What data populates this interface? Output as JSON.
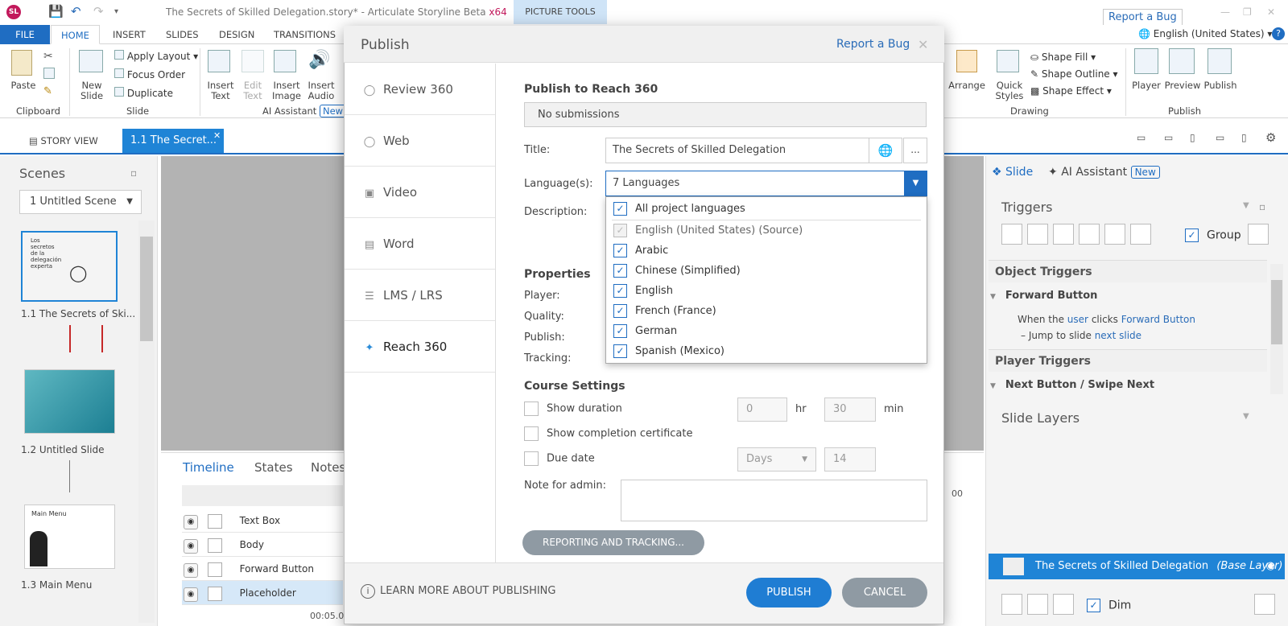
{
  "app": {
    "logo": "SL",
    "window_title": "The Secrets of Skilled Delegation.story* - Articulate Storyline Beta",
    "arch": "x64",
    "picture_tools": "PICTURE TOOLS",
    "report_bug": "Report a Bug",
    "language": "English (United States)",
    "accent": "#1f6dc2"
  },
  "ribbon_tabs": [
    "FILE",
    "HOME",
    "INSERT",
    "SLIDES",
    "DESIGN",
    "TRANSITIONS"
  ],
  "ribbon": {
    "paste": "Paste",
    "clipboard": "Clipboard",
    "new_slide": "New Slide",
    "apply_layout": "Apply Layout",
    "focus_order": "Focus Order",
    "duplicate": "Duplicate",
    "slide_group": "Slide",
    "insert_text": "Insert Text",
    "edit_text": "Edit Text",
    "insert_image": "Insert Image",
    "insert_audio": "Insert Audio",
    "ai_assistant": "AI Assistant",
    "new_badge": "New",
    "arrange": "Arrange",
    "quick_styles": "Quick Styles",
    "shape_fill": "Shape Fill",
    "shape_outline": "Shape Outline",
    "shape_effect": "Shape Effect",
    "drawing": "Drawing",
    "player": "Player",
    "preview": "Preview",
    "publish": "Publish",
    "publish_group": "Publish"
  },
  "strip": {
    "story_view": "STORY VIEW",
    "slide_tab": "1.1 The Secret..."
  },
  "scenes": {
    "title": "Scenes",
    "selected_scene": "1 Untitled Scene",
    "slides": [
      {
        "label": "1.1 The Secrets of Ski..."
      },
      {
        "label": "1.2 Untitled Slide"
      },
      {
        "label": "1.3 Main Menu"
      }
    ],
    "thumb_texts": [
      "Los secretos de la delegación experta",
      "Main Menu"
    ]
  },
  "timeline": {
    "tabs": [
      "Timeline",
      "States",
      "Notes"
    ],
    "rows": [
      "Text Box",
      "Body",
      "Forward Button",
      "Placeholder"
    ],
    "time": "00:05.00",
    "ruler": "00"
  },
  "right_panel": {
    "tab_slide": "Slide",
    "tab_ai": "AI Assistant",
    "new_badge": "New",
    "triggers": "Triggers",
    "group": "Group",
    "object_triggers": "Object Triggers",
    "forward_button": "Forward Button",
    "when_prefix": "When the",
    "when_user": "user",
    "when_clicks": "clicks",
    "when_target": "Forward Button",
    "jump_prefix": "Jump to slide",
    "jump_target": "next slide",
    "player_triggers": "Player Triggers",
    "next_button": "Next Button / Swipe Next",
    "slide_layers": "Slide Layers",
    "base_layer_name": "The Secrets of Skilled Delegation",
    "base_layer_tag": "(Base Layer)",
    "dim": "Dim"
  },
  "modal": {
    "title": "Publish",
    "report_bug": "Report a Bug",
    "nav": [
      "Review 360",
      "Web",
      "Video",
      "Word",
      "LMS / LRS",
      "Reach 360"
    ],
    "section_title": "Publish to Reach 360",
    "submissions": "No submissions",
    "title_label": "Title:",
    "title_value": "The Secrets of Skilled Delegation",
    "dots": "...",
    "languages_label": "Language(s):",
    "languages_value": "7 Languages",
    "description_label": "Description:",
    "lang_options": [
      {
        "label": "All project languages",
        "checked": true,
        "disabled": false
      },
      {
        "label": "English (United States)  (Source)",
        "checked": true,
        "disabled": true
      },
      {
        "label": "Arabic",
        "checked": true,
        "disabled": false
      },
      {
        "label": "Chinese (Simplified)",
        "checked": true,
        "disabled": false
      },
      {
        "label": "English",
        "checked": true,
        "disabled": false
      },
      {
        "label": "French (France)",
        "checked": true,
        "disabled": false
      },
      {
        "label": "German",
        "checked": true,
        "disabled": false
      },
      {
        "label": "Spanish (Mexico)",
        "checked": true,
        "disabled": false
      }
    ],
    "properties": "Properties",
    "player_label": "Player:",
    "quality_label": "Quality:",
    "publish_label": "Publish:",
    "tracking_label": "Tracking:",
    "course_settings": "Course Settings",
    "show_duration": "Show duration",
    "hours": "0",
    "hr": "hr",
    "minutes": "30",
    "min": "min",
    "show_certificate": "Show completion certificate",
    "due_date": "Due date",
    "days": "Days",
    "days_value": "14",
    "note_label": "Note for admin:",
    "reporting_btn": "REPORTING AND TRACKING...",
    "learn_more": "LEARN MORE ABOUT PUBLISHING",
    "publish_btn": "PUBLISH",
    "cancel_btn": "CANCEL"
  }
}
